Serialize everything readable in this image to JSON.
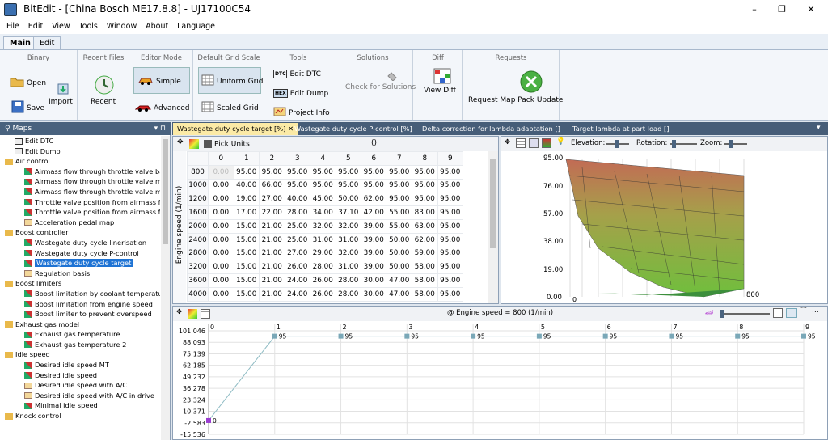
{
  "window": {
    "title": "BitEdit - [China Bosch ME17.8.8] - UJ17100C54",
    "minimize": "–",
    "restore": "❐",
    "close": "✕"
  },
  "menu": [
    "File",
    "Edit",
    "View",
    "Tools",
    "Window",
    "About",
    "Language"
  ],
  "ribbon_tabs": [
    "Main",
    "Edit"
  ],
  "ribbon": {
    "binary": {
      "label": "Binary",
      "open": "Open",
      "save": "Save",
      "import": "Import"
    },
    "recent": {
      "label": "Recent Files",
      "recent": "Recent"
    },
    "editor_mode": {
      "label": "Editor Mode",
      "simple": "Simple",
      "advanced": "Advanced"
    },
    "grid_scale": {
      "label": "Default Grid Scale",
      "uniform": "Uniform Grid",
      "scaled": "Scaled Grid"
    },
    "tools": {
      "label": "Tools",
      "edit_dtc": "Edit DTC",
      "edit_dump": "Edit Dump",
      "project_info": "Project Info"
    },
    "solutions": {
      "label": "Solutions",
      "check": "Check for Solutions"
    },
    "diff": {
      "label": "Diff",
      "view_diff": "View Diff"
    },
    "requests": {
      "label": "Requests",
      "update": "Request Map Pack Update"
    }
  },
  "maps_panel": {
    "title": "Maps",
    "pin": "▾ ⊓"
  },
  "tree": [
    {
      "t": "Edit DTC",
      "lvl": 1,
      "k": "dtc"
    },
    {
      "t": "Edit Dump",
      "lvl": 1,
      "k": "dump"
    },
    {
      "t": "Air control",
      "lvl": 0,
      "k": "folder"
    },
    {
      "t": "Airmass flow through throttle valve bas",
      "lvl": 2,
      "k": "map"
    },
    {
      "t": "Airmass flow through throttle valve mc",
      "lvl": 2,
      "k": "map"
    },
    {
      "t": "Airmass flow through throttle valve mc",
      "lvl": 2,
      "k": "map"
    },
    {
      "t": "Throttle valve position from airmass flc",
      "lvl": 2,
      "k": "map"
    },
    {
      "t": "Throttle valve position from airmass flc",
      "lvl": 2,
      "k": "map"
    },
    {
      "t": "Acceleration pedal map",
      "lvl": 2,
      "k": "grid"
    },
    {
      "t": "Boost controller",
      "lvl": 0,
      "k": "folder"
    },
    {
      "t": "Wastegate duty cycle linerisation",
      "lvl": 2,
      "k": "map"
    },
    {
      "t": "Wastegate duty cycle P-control",
      "lvl": 2,
      "k": "map"
    },
    {
      "t": "Wastegate duty cycle target",
      "lvl": 2,
      "k": "map",
      "sel": true
    },
    {
      "t": "Regulation basis",
      "lvl": 2,
      "k": "grid"
    },
    {
      "t": "Boost limiters",
      "lvl": 0,
      "k": "folder"
    },
    {
      "t": "Boost limitation by coolant temperatur",
      "lvl": 2,
      "k": "map"
    },
    {
      "t": "Boost limitation from engine speed",
      "lvl": 2,
      "k": "map"
    },
    {
      "t": "Boost limiter to prevent overspeed",
      "lvl": 2,
      "k": "map"
    },
    {
      "t": "Exhaust gas model",
      "lvl": 0,
      "k": "folder"
    },
    {
      "t": "Exhaust gas temperature",
      "lvl": 2,
      "k": "map"
    },
    {
      "t": "Exhaust gas temperature 2",
      "lvl": 2,
      "k": "map"
    },
    {
      "t": "Idle speed",
      "lvl": 0,
      "k": "folder"
    },
    {
      "t": "Desired idle speed MT",
      "lvl": 2,
      "k": "map"
    },
    {
      "t": "Desired idle speed",
      "lvl": 2,
      "k": "map"
    },
    {
      "t": "Desired idle speed with A/C",
      "lvl": 2,
      "k": "grid"
    },
    {
      "t": "Desired idle speed with A/C in drive",
      "lvl": 2,
      "k": "grid"
    },
    {
      "t": "Minimal idle speed",
      "lvl": 2,
      "k": "map"
    },
    {
      "t": "Knock control",
      "lvl": 0,
      "k": "folder"
    }
  ],
  "doc_tabs": [
    "Wastegate duty cycle target [%]",
    "Wastegate duty cycle P-control [%]",
    "Delta correction for lambda adaptation []",
    "Target lambda at part load []"
  ],
  "table": {
    "pick_units": "Pick Units",
    "unit_label": "()",
    "ylabel": "Engine speed (1/min)",
    "cols": [
      "0",
      "1",
      "2",
      "3",
      "4",
      "5",
      "6",
      "7",
      "8",
      "9"
    ],
    "rows": [
      {
        "rpm": "800",
        "v": [
          "0.00",
          "95.00",
          "95.00",
          "95.00",
          "95.00",
          "95.00",
          "95.00",
          "95.00",
          "95.00",
          "95.00"
        ]
      },
      {
        "rpm": "1000",
        "v": [
          "0.00",
          "40.00",
          "66.00",
          "95.00",
          "95.00",
          "95.00",
          "95.00",
          "95.00",
          "95.00",
          "95.00"
        ]
      },
      {
        "rpm": "1200",
        "v": [
          "0.00",
          "19.00",
          "27.00",
          "40.00",
          "45.00",
          "50.00",
          "62.00",
          "95.00",
          "95.00",
          "95.00"
        ]
      },
      {
        "rpm": "1600",
        "v": [
          "0.00",
          "17.00",
          "22.00",
          "28.00",
          "34.00",
          "37.10",
          "42.00",
          "55.00",
          "83.00",
          "95.00"
        ]
      },
      {
        "rpm": "2000",
        "v": [
          "0.00",
          "15.00",
          "21.00",
          "25.00",
          "32.00",
          "32.00",
          "39.00",
          "55.00",
          "63.00",
          "95.00"
        ]
      },
      {
        "rpm": "2400",
        "v": [
          "0.00",
          "15.00",
          "21.00",
          "25.00",
          "31.00",
          "31.00",
          "39.00",
          "50.00",
          "62.00",
          "95.00"
        ]
      },
      {
        "rpm": "2800",
        "v": [
          "0.00",
          "15.00",
          "21.00",
          "27.00",
          "29.00",
          "32.00",
          "39.00",
          "50.00",
          "59.00",
          "95.00"
        ]
      },
      {
        "rpm": "3200",
        "v": [
          "0.00",
          "15.00",
          "21.00",
          "26.00",
          "28.00",
          "31.00",
          "39.00",
          "50.00",
          "58.00",
          "95.00"
        ]
      },
      {
        "rpm": "3600",
        "v": [
          "0.00",
          "15.00",
          "21.00",
          "24.00",
          "26.00",
          "28.00",
          "30.00",
          "47.00",
          "58.00",
          "95.00"
        ]
      },
      {
        "rpm": "4000",
        "v": [
          "0.00",
          "15.00",
          "21.00",
          "24.00",
          "26.00",
          "28.00",
          "30.00",
          "47.00",
          "58.00",
          "95.00"
        ]
      }
    ]
  },
  "graph3d": {
    "elevation": "Elevation:",
    "rotation": "Rotation:",
    "zoom": "Zoom:",
    "zticks": [
      "95.00",
      "76.00",
      "57.00",
      "38.00",
      "19.00",
      "0.00"
    ],
    "corner_label": "800",
    "x0": "0"
  },
  "chart_data": {
    "type": "line",
    "title": "@ Engine speed = 800 (1/min)",
    "x": [
      0,
      1,
      2,
      3,
      4,
      5,
      6,
      7,
      8,
      9
    ],
    "x_tick_labels": [
      "0",
      "1",
      "2",
      "3",
      "4",
      "5",
      "6",
      "7",
      "8",
      "9"
    ],
    "series": [
      {
        "values": [
          0,
          95,
          95,
          95,
          95,
          95,
          95,
          95,
          95,
          95
        ]
      }
    ],
    "point_labels": [
      "0",
      "95",
      "95",
      "95",
      "95",
      "95",
      "95",
      "95",
      "95",
      "95"
    ],
    "y_tick_labels": [
      "101.046",
      "88.093",
      "75.139",
      "62.185",
      "49.232",
      "36.278",
      "23.324",
      "10.371",
      "-2.583",
      "-15.536"
    ],
    "ylim": [
      -15.536,
      101.046
    ],
    "grid": true,
    "colors": {
      "line": "#8fbcc4",
      "point": "#7aa8b8",
      "first_point": "#9b3dd1"
    }
  }
}
